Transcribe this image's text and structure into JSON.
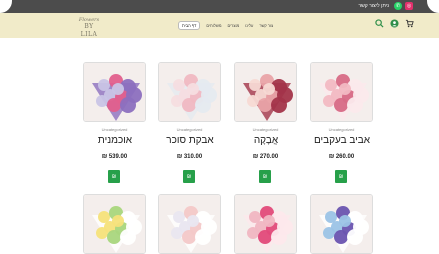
{
  "topbar": {
    "contact_text": "ניתן ליצור קשר",
    "icons": [
      "instagram-icon",
      "whatsapp-icon"
    ]
  },
  "logo": {
    "line1": "Flowers",
    "line2": "BY LILA"
  },
  "nav": {
    "items": [
      {
        "label": "צור קשר"
      },
      {
        "label": "עלינו"
      },
      {
        "label": "מוצרים"
      },
      {
        "label": "משלוחים"
      },
      {
        "label": "דף הבית"
      }
    ]
  },
  "header_icons": [
    "cart-icon",
    "user-icon",
    "search-icon"
  ],
  "products": [
    {
      "category": "Uncategorized",
      "name": "אביב בעקבים",
      "price": "260.00 ₪",
      "cart_label": "₪",
      "colors": [
        "#f2b9c3",
        "#d76a86",
        "#fbe9ec"
      ]
    },
    {
      "category": "Uncategorized",
      "name": "אֲבָקָה",
      "price": "270.00 ₪",
      "cart_label": "₪",
      "colors": [
        "#f7d9d4",
        "#e9a3a8",
        "#a3344a"
      ]
    },
    {
      "category": "Uncategorized",
      "name": "אבקת סוכר",
      "price": "310.00 ₪",
      "cart_label": "₪",
      "colors": [
        "#f5dde0",
        "#f0b8c2",
        "#e5eaf0"
      ]
    },
    {
      "category": "Uncategorized",
      "name": "אוכמנית",
      "price": "539.00 ₪",
      "cart_label": "₪",
      "colors": [
        "#c9c4e6",
        "#e15f8d",
        "#8c6fbf"
      ]
    }
  ],
  "products_row2": [
    {
      "colors": [
        "#9bc3e6",
        "#6a54b0",
        "#fff"
      ]
    },
    {
      "colors": [
        "#f0b6c2",
        "#e14a7a",
        "#fde8ec"
      ]
    },
    {
      "colors": [
        "#e9e6f0",
        "#f3c8c8",
        "#fff"
      ]
    },
    {
      "colors": [
        "#f6e27a",
        "#a9d67d",
        "#ffffff"
      ]
    }
  ]
}
